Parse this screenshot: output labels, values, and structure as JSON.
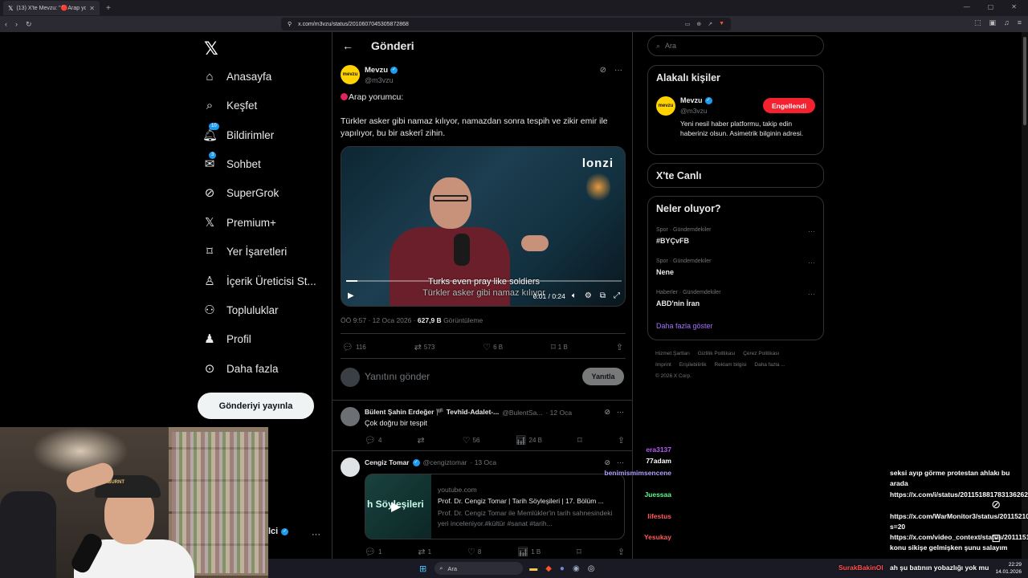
{
  "browser": {
    "tab_title": "(13) X'te Mevzu: \"🔴Arap yorumcu...",
    "url": "x.com/m3vzu/status/2010607045305872868"
  },
  "nav": {
    "items": [
      {
        "label": "Anasayfa",
        "icon": "home-icon"
      },
      {
        "label": "Keşfet",
        "icon": "search-icon"
      },
      {
        "label": "Bildirimler",
        "icon": "bell-icon",
        "badge": "10"
      },
      {
        "label": "Sohbet",
        "icon": "mail-icon",
        "badge": "3"
      },
      {
        "label": "SuperGrok",
        "icon": "grok-icon"
      },
      {
        "label": "Premium+",
        "icon": "x-icon"
      },
      {
        "label": "Yer İşaretleri",
        "icon": "bookmark-icon"
      },
      {
        "label": "İçerik Üreticisi St...",
        "icon": "creator-icon"
      },
      {
        "label": "Topluluklar",
        "icon": "communities-icon"
      },
      {
        "label": "Profil",
        "icon": "profile-icon"
      },
      {
        "label": "Daha fazla",
        "icon": "more-circle-icon"
      }
    ],
    "post_button": "Gönderiyi yayınla",
    "account_name": "lci"
  },
  "header": {
    "title": "Gönderi"
  },
  "tweet": {
    "author": "Mevzu",
    "avatar_text": "mevzu",
    "handle": "@m3vzu",
    "line1": "Arap yorumcu:",
    "body": "Türkler asker gibi namaz kılıyor, namazdan sonra tespih ve zikir emir ile yapılıyor, bu bir askerî zihin.",
    "video": {
      "logo": "lonzi",
      "subtitle_en": "Turks even pray like soldiers",
      "subtitle_tr": "Türkler asker gibi namaz kılıyor",
      "time": "0:01 / 0:24",
      "progress": 0.04
    },
    "timestamp": "ÖÖ 9:57 · 12 Oca 2026 · ",
    "views": "627,9 B",
    "views_label": " Görüntüleme",
    "stats": {
      "replies": "116",
      "reposts": "573",
      "likes": "6 B",
      "bookmarks": "1 B"
    }
  },
  "reply_box": {
    "placeholder": "Yanıtını gönder",
    "button": "Yanıtla"
  },
  "comments": [
    {
      "name": "Bülent Şahin Erdeğer 🏴 Tevhîd-Adalet-...",
      "handle": "@BulentSa...",
      "date": "· 12 Oca",
      "text": "Çok doğru bir tespit",
      "replies": "4",
      "reposts": "",
      "likes": "56",
      "views": "24 B"
    },
    {
      "name": "Cengiz Tomar",
      "handle": "@cengiztomar",
      "date": "· 13 Oca",
      "card": {
        "thumb_text": "h Söyleşileri",
        "domain": "youtube.com",
        "title": "Prof. Dr. Cengiz Tomar | Tarih Söyleşileri | 17. Bölüm ...",
        "desc": "Prof. Dr. Cengiz Tomar ile Memlükler'in tarih sahnesindeki yeri inceleniyor.#kültür #sanat #tarih..."
      },
      "replies": "1",
      "reposts": "1",
      "likes": "8",
      "views": "1 B"
    }
  ],
  "right": {
    "search_placeholder": "Ara",
    "related_title": "Alakalı kişiler",
    "related": {
      "name": "Mevzu",
      "handle": "@m3vzu",
      "button": "Engellendi",
      "bio": "Yeni nesil haber platformu, takip edin haberiniz olsun. Asimetrik bilginin adresi."
    },
    "live_title": "X'te Canlı",
    "trends_title": "Neler oluyor?",
    "trends": [
      {
        "category": "Spor · Gündemdekiler",
        "name": "#BYÇvFB"
      },
      {
        "category": "Spor · Gündemdekiler",
        "name": "Nene"
      },
      {
        "category": "Haberler · Gündemdekiler",
        "name": "ABD'nin İran"
      }
    ],
    "show_more": "Daha fazla göster",
    "footer": [
      "Hizmet Şartları",
      "Gizlilik Politikası",
      "Çerez Politikası",
      "Imprint",
      "Erişilebilirlik",
      "Reklam bilgisi",
      "Daha fazla ...",
      "© 2026 X Corp."
    ]
  },
  "webcam": {
    "cap_text": "BURNT"
  },
  "chat": [
    {
      "user": "era3137",
      "text": "",
      "color": "#b45cff"
    },
    {
      "user": "77adam",
      "text": "",
      "color": "#ffffff"
    },
    {
      "user": "benimismimsencene",
      "text": "seksi ayıp görme protestan ahlakı bu arada",
      "color": "#b4a0ff"
    },
    {
      "user": "Juessaa",
      "text": "https://x.com/i/status/2011518817831362625",
      "color": "#5cff8a"
    },
    {
      "user": "lifestus",
      "text": "https://x.com/WarMonitor3/status/2011521001574773133?s=20",
      "color": "#ff5c5c"
    },
    {
      "user": "Yesukay",
      "text": "https://x.com/video_context/status/2011151263493153150 konu sikişe gelmişken şunu salayım",
      "color": "#ff5c5c"
    }
  ],
  "last_chat": {
    "user": "SurakBakinOl",
    "text": "ah şu batının yobazlığı yok mu"
  },
  "taskbar": {
    "search": "Ara",
    "time": "22:29",
    "date": "14.01.2026"
  }
}
